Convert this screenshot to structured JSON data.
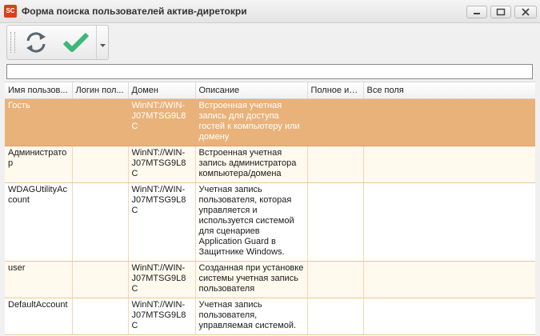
{
  "window": {
    "title": "Форма поиска пользователей актив-диретокри",
    "icon_text": "SC",
    "controls": [
      "minimize-icon",
      "maximize-icon",
      "close-icon"
    ]
  },
  "toolbar": {
    "refresh_icon": "refresh-icon",
    "confirm_icon": "checkmark-icon",
    "dropdown_icon": "chevron-down-icon"
  },
  "search": {
    "value": "",
    "placeholder": ""
  },
  "table": {
    "columns": [
      "Имя пользов...",
      "Логин пол...",
      "Домен",
      "Описание",
      "Полное имя",
      "Все поля"
    ],
    "rows": [
      {
        "name": "Гость",
        "login": "",
        "domain": "WinNT://WIN-J07MTSG9L8C",
        "description": "Встроенная учетная запись для доступа гостей к компьютеру или домену",
        "full_name": "",
        "all_fields": ""
      },
      {
        "name": "Администратор",
        "login": "",
        "domain": "WinNT://WIN-J07MTSG9L8C",
        "description": "Встроенная учетная запись администратора компьютера/домена",
        "full_name": "",
        "all_fields": ""
      },
      {
        "name": "WDAGUtilityAccount",
        "login": "",
        "domain": "WinNT://WIN-J07MTSG9L8C",
        "description": "Учетная запись пользователя, которая управляется и используется системой для сценариев Application Guard в Защитнике Windows.",
        "full_name": "",
        "all_fields": ""
      },
      {
        "name": "user",
        "login": "",
        "domain": "WinNT://WIN-J07MTSG9L8C",
        "description": "Созданная при установке системы учетная запись пользователя",
        "full_name": "",
        "all_fields": ""
      },
      {
        "name": "DefaultAccount",
        "login": "",
        "domain": "WinNT://WIN-J07MTSG9L8C",
        "description": "Учетная запись пользователя, управляемая системой.",
        "full_name": "",
        "all_fields": ""
      }
    ],
    "selected_row": 0
  },
  "colors": {
    "selected_row": "#e9b27a",
    "accent_check": "#3cb878",
    "app_icon": "#d7421b"
  }
}
